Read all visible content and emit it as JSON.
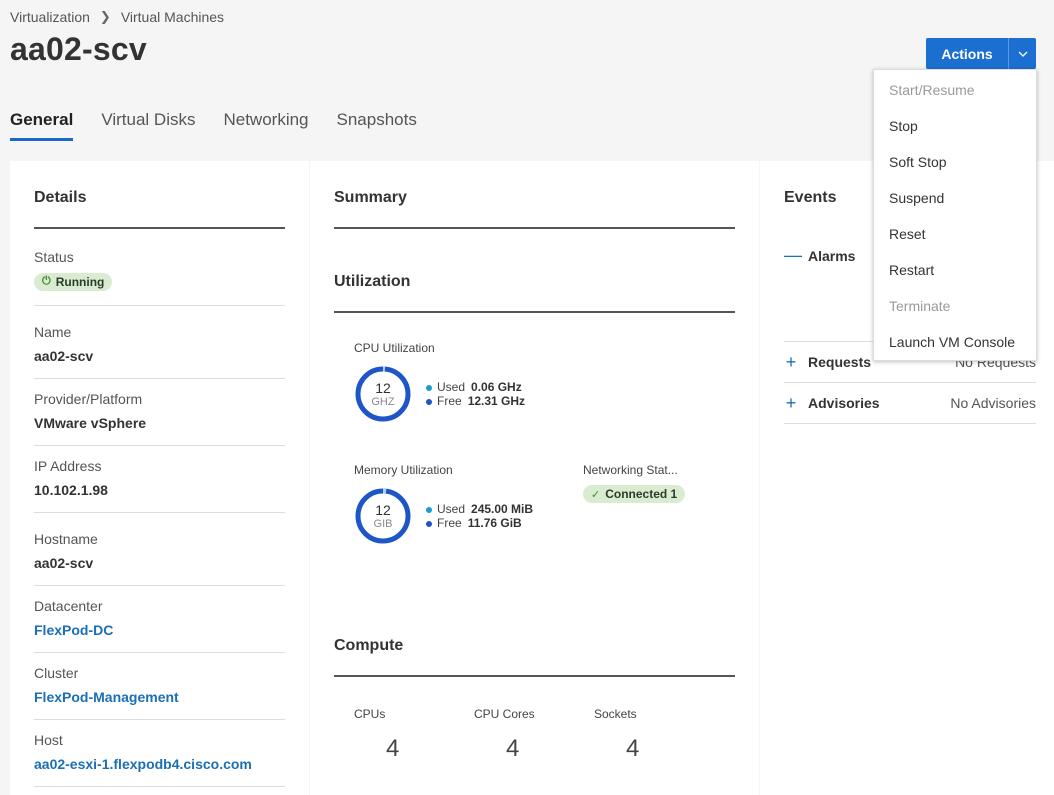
{
  "breadcrumb": {
    "parent": "Virtualization",
    "current": "Virtual Machines"
  },
  "title": "aa02-scv",
  "tabs": [
    {
      "label": "General",
      "active": true
    },
    {
      "label": "Virtual Disks",
      "active": false
    },
    {
      "label": "Networking",
      "active": false
    },
    {
      "label": "Snapshots",
      "active": false
    }
  ],
  "actions": {
    "label": "Actions",
    "menu": [
      {
        "label": "Start/Resume",
        "disabled": true
      },
      {
        "label": "Stop",
        "disabled": false
      },
      {
        "label": "Soft Stop",
        "disabled": false
      },
      {
        "label": "Suspend",
        "disabled": false
      },
      {
        "label": "Reset",
        "disabled": false
      },
      {
        "label": "Restart",
        "disabled": false
      },
      {
        "label": "Terminate",
        "disabled": true
      },
      {
        "label": "Launch VM Console",
        "disabled": false
      }
    ]
  },
  "details": {
    "title": "Details",
    "status_label": "Status",
    "status_value": "Running",
    "name_label": "Name",
    "name_value": "aa02-scv",
    "provider_label": "Provider/Platform",
    "provider_value": "VMware vSphere",
    "ip_label": "IP Address",
    "ip_value": "10.102.1.98",
    "hostname_label": "Hostname",
    "hostname_value": "aa02-scv",
    "datacenter_label": "Datacenter",
    "datacenter_value": "FlexPod-DC",
    "cluster_label": "Cluster",
    "cluster_value": "FlexPod-Management",
    "host_label": "Host",
    "host_value": "aa02-esxi-1.flexpodb4.cisco.com"
  },
  "summary": {
    "title": "Summary",
    "utilization_title": "Utilization",
    "cpu": {
      "label": "CPU Utilization",
      "total": "12",
      "unit": "GHZ",
      "used_label": "Used",
      "used_value": "0.06 GHz",
      "free_label": "Free",
      "free_value": "12.31 GHz",
      "used_fraction": 0.005
    },
    "memory": {
      "label": "Memory Utilization",
      "total": "12",
      "unit": "GIB",
      "used_label": "Used",
      "used_value": "245.00 MiB",
      "free_label": "Free",
      "free_value": "11.76 GiB",
      "used_fraction": 0.02
    },
    "networking": {
      "label": "Networking Stat...",
      "badge": "Connected 1"
    },
    "compute_title": "Compute",
    "compute": [
      {
        "label": "CPUs",
        "value": "4"
      },
      {
        "label": "CPU Cores",
        "value": "4"
      },
      {
        "label": "Sockets",
        "value": "4"
      }
    ]
  },
  "events": {
    "title": "Events",
    "alarms_label": "Alarms",
    "requests_label": "Requests",
    "requests_value": "No Requests",
    "advisories_label": "Advisories",
    "advisories_value": "No Advisories"
  },
  "colors": {
    "accent": "#1a6fd1",
    "ring": "#1e56c8",
    "used_dot": "#1c9ad6",
    "free_dot": "#1e56c8",
    "badge_bg": "#d9ecd2"
  }
}
